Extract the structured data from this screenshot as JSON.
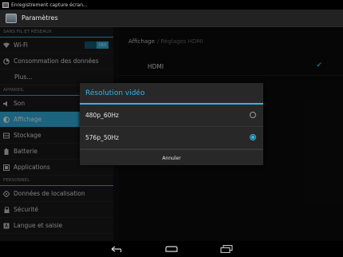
{
  "statusbar": {
    "notification": "Enregistrement capture écran..."
  },
  "actionbar": {
    "title": "Paramètres"
  },
  "sidebar": {
    "sections": [
      {
        "header": "SANS FIL ET RÉSEAUX"
      },
      {
        "header": "APPAREIL"
      },
      {
        "header": "PERSONNEL"
      }
    ],
    "items": [
      {
        "label": "Wi-Fi",
        "icon": "wifi-icon",
        "toggle_label": "OUI"
      },
      {
        "label": "Consommation des données",
        "icon": "data-usage-icon"
      },
      {
        "label": "Plus..."
      },
      {
        "label": "Son",
        "icon": "speaker-icon"
      },
      {
        "label": "Affichage",
        "icon": "display-icon",
        "active": true
      },
      {
        "label": "Stockage",
        "icon": "storage-icon"
      },
      {
        "label": "Batterie",
        "icon": "battery-icon"
      },
      {
        "label": "Applications",
        "icon": "apps-icon"
      },
      {
        "label": "Données de localisation",
        "icon": "location-icon"
      },
      {
        "label": "Sécurité",
        "icon": "lock-icon"
      },
      {
        "label": "Langue et saisie",
        "icon": "language-icon"
      }
    ]
  },
  "content": {
    "breadcrumb_main": "Affichage",
    "breadcrumb_sub": "/ Réglages HDMI",
    "hdmi_label": "HDMI",
    "hdmi_checked": true
  },
  "dialog": {
    "title": "Résolution vidéo",
    "options": [
      {
        "label": "480p_60Hz",
        "selected": false
      },
      {
        "label": "576p_50Hz",
        "selected": true
      }
    ],
    "cancel": "Annuler"
  },
  "navbar": {
    "back": "back-icon",
    "home": "home-icon",
    "recents": "recents-icon"
  },
  "colors": {
    "accent": "#33b5e5",
    "background": "#101010"
  }
}
